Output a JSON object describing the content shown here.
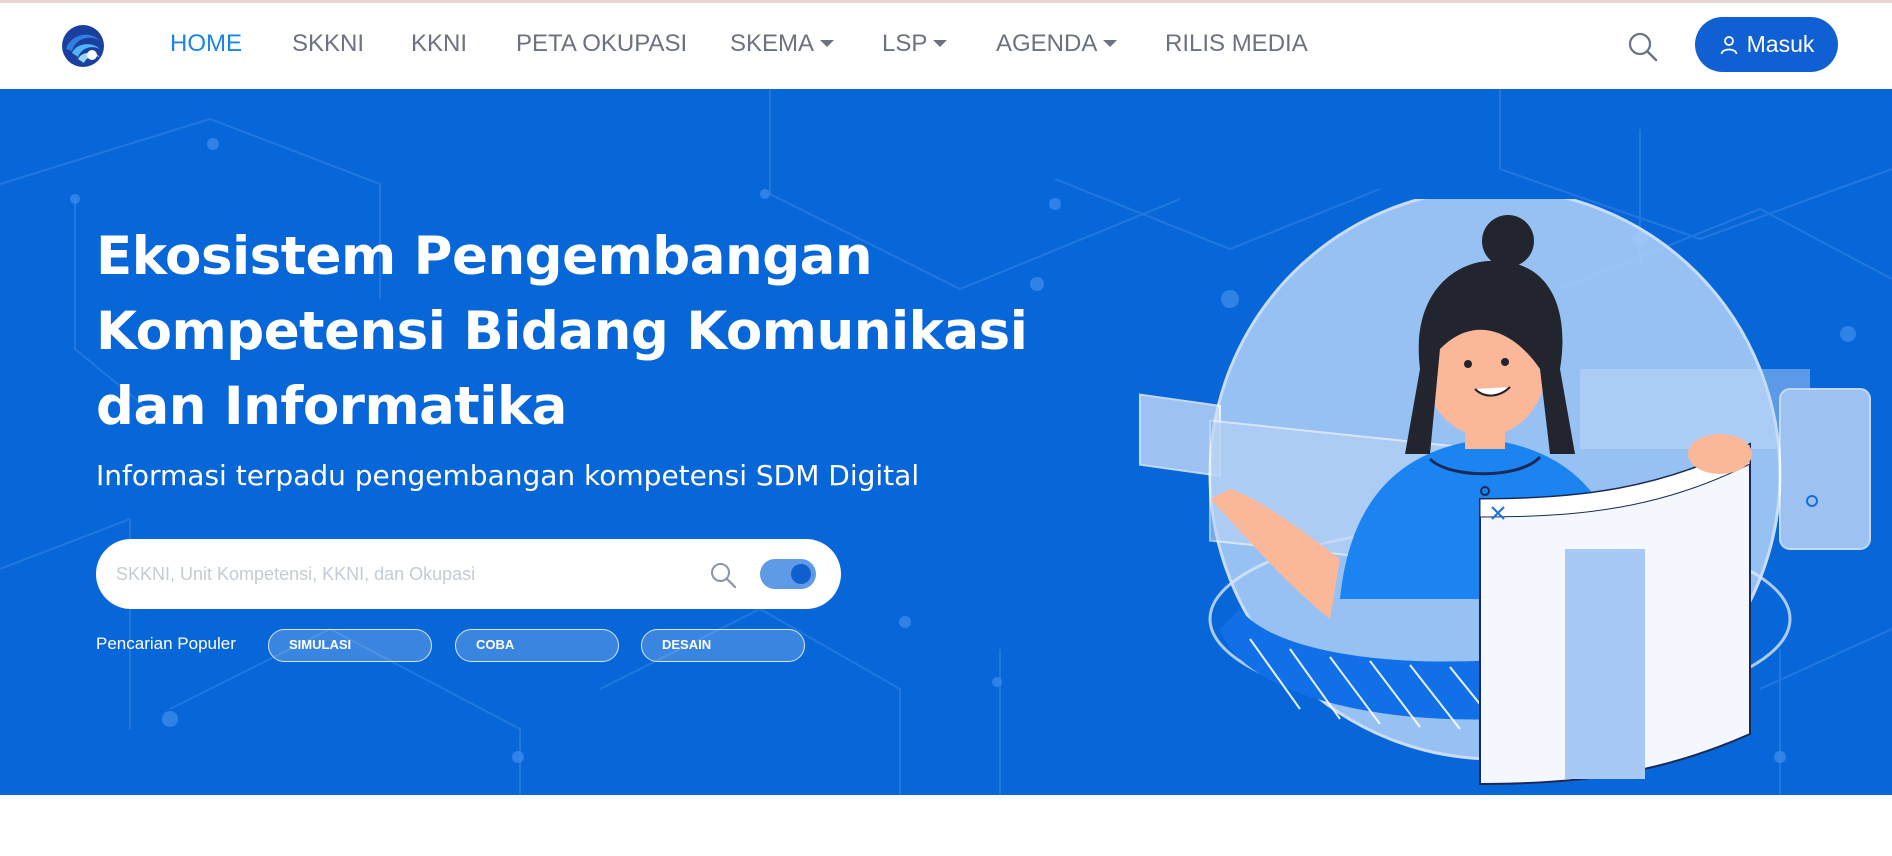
{
  "nav": {
    "items": [
      {
        "label": "HOME",
        "active": true,
        "dropdown": false
      },
      {
        "label": "SKKNI",
        "active": false,
        "dropdown": false
      },
      {
        "label": "KKNI",
        "active": false,
        "dropdown": false
      },
      {
        "label": "PETA OKUPASI",
        "active": false,
        "dropdown": false
      },
      {
        "label": "SKEMA",
        "active": false,
        "dropdown": true
      },
      {
        "label": "LSP",
        "active": false,
        "dropdown": true
      },
      {
        "label": "AGENDA",
        "active": false,
        "dropdown": true
      },
      {
        "label": "RILIS MEDIA",
        "active": false,
        "dropdown": false
      }
    ],
    "login_label": "Masuk",
    "search_icon": "search-icon",
    "user_icon": "user-icon"
  },
  "hero": {
    "title_lines": [
      "Ekosistem Pengembangan",
      "Kompetensi Bidang Komunikasi",
      "dan Informatika"
    ],
    "subtitle": "Informasi terpadu pengembangan kompetensi SDM Digital",
    "search": {
      "placeholder": "SKKNI, Unit Kompetensi, KKNI, dan Okupasi",
      "value": "",
      "toggle_on": true
    },
    "popular_label": "Pencarian Populer",
    "popular_chips": [
      "SIMULASI",
      "COBA",
      "DESAIN"
    ]
  },
  "colors": {
    "accent": "#1b84e7",
    "hero_bg": "#0867d8",
    "button": "#1160d3"
  }
}
